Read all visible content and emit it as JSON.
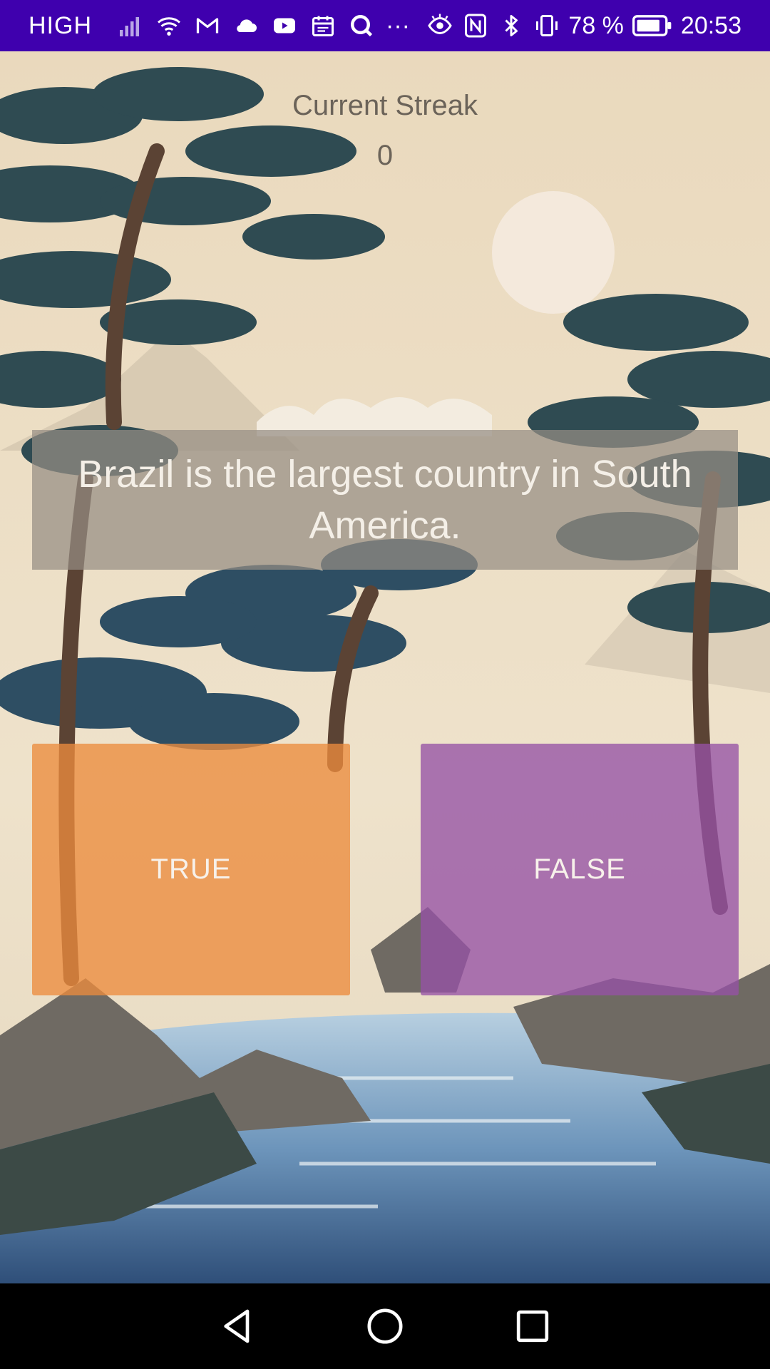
{
  "status_bar": {
    "carrier": "HIGH",
    "battery_text": "78 %",
    "time": "20:53",
    "more_indicator": "···",
    "icons_left": [
      "signal-icon",
      "wifi-icon",
      "mail-icon",
      "cloud-icon",
      "youtube-icon",
      "calendar-icon",
      "search-app-icon"
    ],
    "icons_right": [
      "eye-icon",
      "nfc-icon",
      "bluetooth-icon",
      "vibrate-icon",
      "battery-icon"
    ],
    "background_color": "#3f00ae"
  },
  "streak": {
    "label": "Current Streak",
    "value": "0"
  },
  "question": {
    "text": "Brazil is the largest country in South America."
  },
  "answers": {
    "true_label": "TRUE",
    "false_label": "FALSE",
    "true_color": "#ec8c3e",
    "false_color": "#9652a5"
  },
  "nav_bar": {
    "icons": [
      "back-icon",
      "home-icon",
      "recents-icon"
    ]
  }
}
